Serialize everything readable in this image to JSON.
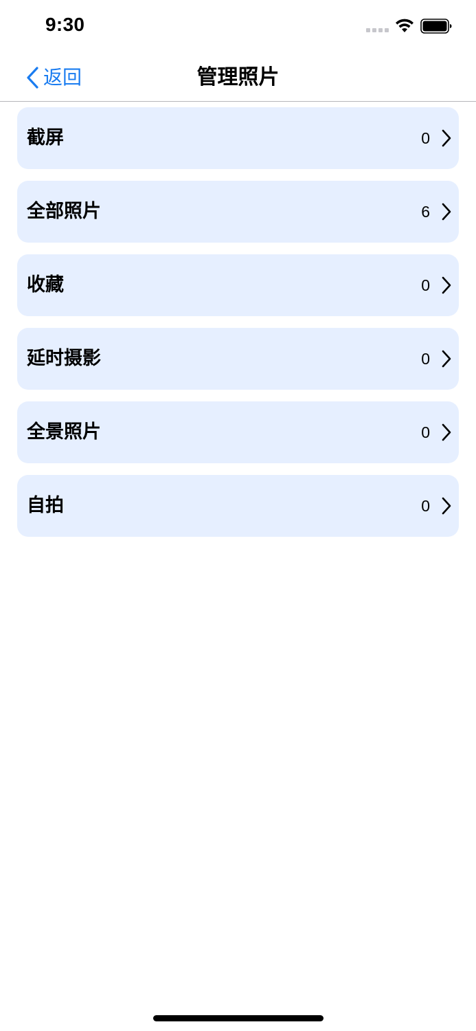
{
  "status_bar": {
    "time": "9:30"
  },
  "nav": {
    "back_label": "返回",
    "title": "管理照片"
  },
  "albums": [
    {
      "name": "截屏",
      "count": "0"
    },
    {
      "name": "全部照片",
      "count": "6"
    },
    {
      "name": "收藏",
      "count": "0"
    },
    {
      "name": "延时摄影",
      "count": "0"
    },
    {
      "name": "全景照片",
      "count": "0"
    },
    {
      "name": "自拍",
      "count": "0"
    }
  ],
  "colors": {
    "accent": "#1a7cf0",
    "row_background": "#e6efff"
  },
  "icons": {
    "back": "chevron-left-icon",
    "row_disclosure": "chevron-right-icon",
    "wifi": "wifi-icon",
    "battery": "battery-icon",
    "cellular": "cellular-signal-icon"
  }
}
